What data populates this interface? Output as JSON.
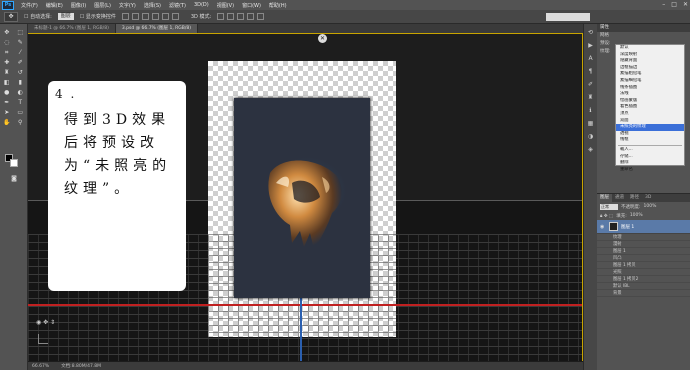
{
  "menubar": {
    "logo": "Ps",
    "items": [
      "文件(F)",
      "编辑(E)",
      "图像(I)",
      "图层(L)",
      "文字(Y)",
      "选择(S)",
      "滤镜(T)",
      "3D(D)",
      "视图(V)",
      "窗口(W)",
      "帮助(H)"
    ]
  },
  "options": {
    "auto_select": "自动选择:",
    "auto_select_value": "图层",
    "show_transform": "显示变换控件",
    "mode_3d": "3D 模式:"
  },
  "tabs": [
    {
      "label": "未标题-1 @ 66.7% (图层 1, RGB/8)",
      "active": false
    },
    {
      "label": "3.psd @ 66.7% (图层 1, RGB/8)",
      "active": true
    }
  ],
  "note": {
    "number": "4 .",
    "text": "得到3D效果后将预设改为“未照亮的纹理”。"
  },
  "status": {
    "zoom": "66.67%",
    "doc": "文档:8.80M/47.8M"
  },
  "right_panel": {
    "header": "属性",
    "rows": [
      "网格",
      "预设:",
      "纹理:"
    ]
  },
  "dropdown": {
    "items": [
      {
        "label": "默认",
        "selected": false
      },
      {
        "label": "深度映射",
        "selected": false
      },
      {
        "label": "隐藏背面",
        "selected": false
      },
      {
        "label": "边框描边",
        "selected": false
      },
      {
        "label": "素描粗铅笔",
        "selected": false
      },
      {
        "label": "素描细铅笔",
        "selected": false
      },
      {
        "label": "线条插图",
        "selected": false
      },
      {
        "label": "法线",
        "selected": false
      },
      {
        "label": "绘画蒙版",
        "selected": false
      },
      {
        "label": "着色插图",
        "selected": false
      },
      {
        "label": "顶点",
        "selected": false
      },
      {
        "label": "双面",
        "selected": false
      },
      {
        "label": "未照亮的纹理",
        "selected": true
      },
      {
        "label": "透视",
        "selected": false
      },
      {
        "label": "线框",
        "selected": false
      },
      {
        "label": "载入...",
        "selected": false
      },
      {
        "label": "存储...",
        "selected": false
      },
      {
        "label": "删除",
        "selected": false
      },
      {
        "label": "重命名",
        "selected": false
      }
    ]
  },
  "layers": {
    "tabs": [
      "图层",
      "通道",
      "路径",
      "3D"
    ],
    "blend_label": "正常",
    "opacity_label": "不透明度:",
    "opacity_value": "100%",
    "fill_label": "填充:",
    "fill_value": "100%",
    "active_layer": "图层 1",
    "sub_rows": [
      "纹理",
      "漫射",
      "图层 1",
      "凹凸",
      "图层 1 拷贝",
      "光照",
      "图层 1 拷贝2",
      "默认 IBL",
      "背景"
    ]
  },
  "colors": {
    "accent": "#3b6fd8",
    "red_axis": "#c02020",
    "blue_axis": "#2a5fb0",
    "border_gold": "#c8a400"
  }
}
